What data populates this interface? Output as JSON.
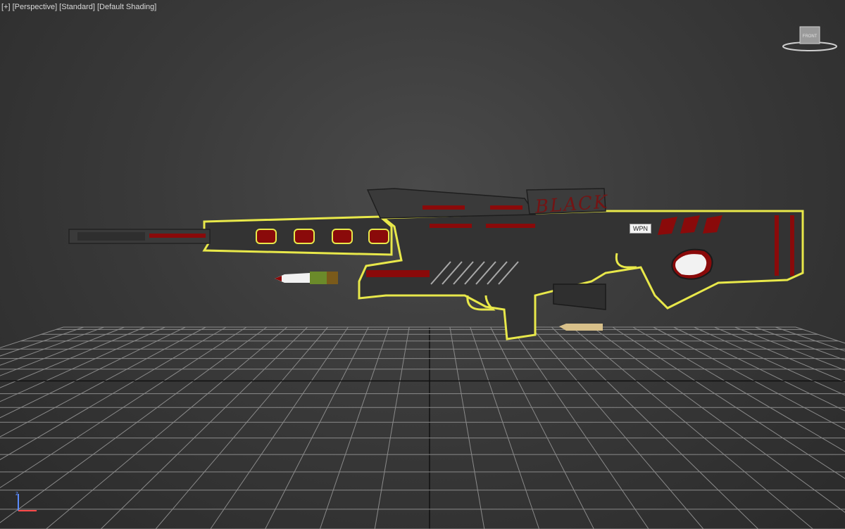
{
  "viewport": {
    "labels": [
      "+",
      "Perspective",
      "Standard",
      "Default Shading"
    ]
  },
  "viewcube": {
    "face_label": "FRONT"
  },
  "scene": {
    "object_tag": "WPN",
    "decal_text": "BLACK"
  },
  "colors": {
    "selection_outline": "#e8e84a",
    "accent_red": "#8a0a0a",
    "body": "#3a3a3a",
    "grid_line": "#8a8a8a",
    "grid_major": "#111111"
  },
  "axis_gizmo": {
    "icon": "axis-tripod-icon",
    "labels": [
      "z"
    ]
  }
}
